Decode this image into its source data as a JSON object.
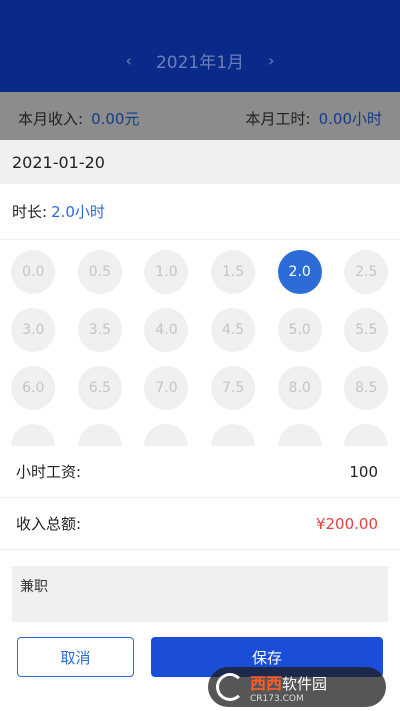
{
  "header": {
    "month": "2021年1月",
    "prev_icon": "chevron-left-icon",
    "next_icon": "chevron-right-icon"
  },
  "stats": {
    "income_label": "本月收入:",
    "income_value": "0.00元",
    "hours_label": "本月工时:",
    "hours_value": "0.00小时"
  },
  "sheet": {
    "date": "2021-01-20",
    "duration_label": "时长:",
    "duration_value": "2.0小时",
    "options": [
      "0.0",
      "0.5",
      "1.0",
      "1.5",
      "2.0",
      "2.5",
      "3.0",
      "3.5",
      "4.0",
      "4.5",
      "5.0",
      "5.5",
      "6.0",
      "6.5",
      "7.0",
      "7.5",
      "8.0",
      "8.5",
      "",
      "",
      "",
      "",
      "",
      ""
    ],
    "selected": "2.0",
    "hourly_label": "小时工资:",
    "hourly_value": "100",
    "total_label": "收入总额:",
    "total_value": "¥200.00",
    "note": "兼职",
    "cancel_label": "取消",
    "save_label": "保存"
  },
  "colors": {
    "primary": "#1a4ed6",
    "accent": "#2d6cd6",
    "total": "#e0433d",
    "header": "#0a2a8a"
  },
  "watermark": {
    "brand": "西西",
    "text": "软件园",
    "site": "CR173.COM"
  }
}
